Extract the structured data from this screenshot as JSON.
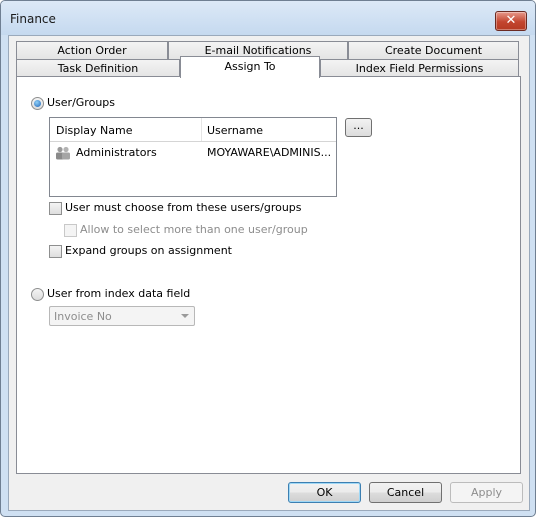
{
  "window": {
    "title": "Finance"
  },
  "tabs": {
    "row1": [
      "Action Order",
      "E-mail Notifications",
      "Create Document"
    ],
    "row2": [
      "Task Definition",
      "Assign To",
      "Index Field Permissions"
    ],
    "selected": "Assign To"
  },
  "assign": {
    "user_groups_label": "User/Groups",
    "user_groups_checked": true,
    "columns": [
      "Display Name",
      "Username"
    ],
    "rows": [
      {
        "display_name": "Administrators",
        "username": "MOYAWARE\\ADMINIS..."
      }
    ],
    "browse_label": "...",
    "must_choose_label": "User must choose from these users/groups",
    "allow_multi_label": "Allow to select more than one user/group",
    "expand_groups_label": "Expand groups on assignment",
    "index_field_label": "User from index data field",
    "index_field_checked": false,
    "index_field_value": "Invoice No"
  },
  "buttons": {
    "ok": "OK",
    "cancel": "Cancel",
    "apply": "Apply"
  },
  "colors": {
    "selection_dot": "#1e63b8",
    "close_button": "#c3452f"
  }
}
